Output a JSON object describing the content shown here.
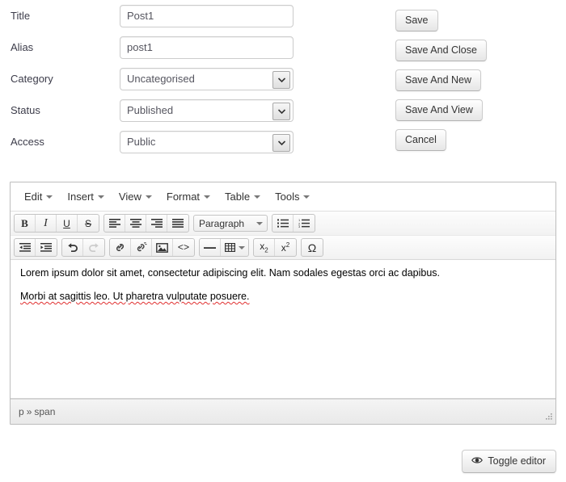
{
  "form": {
    "fields": [
      {
        "label": "Title",
        "type": "text",
        "value": "Post1",
        "placeholder": ""
      },
      {
        "label": "Alias",
        "type": "text",
        "value": "post1",
        "placeholder": ""
      },
      {
        "label": "Category",
        "type": "select",
        "value": "Uncategorised",
        "options": [
          "Uncategorised"
        ]
      },
      {
        "label": "Status",
        "type": "select",
        "value": "Published",
        "options": [
          "Published"
        ]
      },
      {
        "label": "Access",
        "type": "select",
        "value": "Public",
        "options": [
          "Public"
        ]
      }
    ]
  },
  "actions": {
    "buttons": [
      {
        "label": "Save"
      },
      {
        "label": "Save And Close"
      },
      {
        "label": "Save And New"
      },
      {
        "label": "Save And View"
      },
      {
        "label": "Cancel"
      }
    ]
  },
  "editor": {
    "menubar": [
      {
        "label": "Edit"
      },
      {
        "label": "Insert"
      },
      {
        "label": "View"
      },
      {
        "label": "Format"
      },
      {
        "label": "Table"
      },
      {
        "label": "Tools"
      }
    ],
    "toolbar_row1": {
      "group_format": [
        {
          "icon": "bold-icon",
          "title": "Bold"
        },
        {
          "icon": "italic-icon",
          "title": "Italic"
        },
        {
          "icon": "underline-icon",
          "title": "Underline"
        },
        {
          "icon": "strikethrough-icon",
          "title": "Strikethrough"
        }
      ],
      "group_align": [
        {
          "icon": "align-left-icon",
          "title": "Align left"
        },
        {
          "icon": "align-center-icon",
          "title": "Align center"
        },
        {
          "icon": "align-right-icon",
          "title": "Align right"
        },
        {
          "icon": "align-justify-icon",
          "title": "Justify"
        }
      ],
      "style_select": {
        "value": "Paragraph",
        "options": [
          "Paragraph"
        ]
      },
      "group_lists": [
        {
          "icon": "bullet-list-icon",
          "title": "Bullet list"
        },
        {
          "icon": "numbered-list-icon",
          "title": "Numbered list"
        }
      ]
    },
    "toolbar_row2": {
      "group_indent": [
        {
          "icon": "outdent-icon",
          "title": "Decrease indent"
        },
        {
          "icon": "indent-icon",
          "title": "Increase indent"
        }
      ],
      "group_history": [
        {
          "icon": "undo-icon",
          "title": "Undo",
          "disabled": false
        },
        {
          "icon": "redo-icon",
          "title": "Redo",
          "disabled": true
        }
      ],
      "group_insert": [
        {
          "icon": "link-icon",
          "title": "Insert/edit link"
        },
        {
          "icon": "unlink-icon",
          "title": "Remove link"
        },
        {
          "icon": "image-icon",
          "title": "Insert/edit image"
        },
        {
          "icon": "sourcecode-icon",
          "title": "Source code"
        }
      ],
      "group_objects": [
        {
          "icon": "horizontal-rule-icon",
          "title": "Horizontal line"
        },
        {
          "icon": "table-icon",
          "title": "Table",
          "has_caret": true
        }
      ],
      "group_script": [
        {
          "icon": "subscript-icon",
          "title": "Subscript",
          "glyph": "x₂"
        },
        {
          "icon": "superscript-icon",
          "title": "Superscript",
          "glyph": "x²"
        }
      ],
      "group_special": [
        {
          "icon": "special-character-icon",
          "title": "Special character",
          "glyph": "Ω"
        }
      ]
    },
    "content": {
      "paragraphs": [
        {
          "text": "Lorem ipsum dolor sit amet, consectetur adipiscing elit. Nam sodales egestas orci ac dapibus.",
          "misspelled": false
        },
        {
          "text": "Morbi at sagittis leo. Ut pharetra vulputate posuere.",
          "misspelled": true
        }
      ]
    },
    "statusbar": {
      "path": [
        "p",
        "span"
      ],
      "separator": "»"
    }
  },
  "footer": {
    "toggle_button": {
      "label": "Toggle editor",
      "icon": "eye-icon"
    }
  },
  "colors": {
    "page_background": "#ffffff",
    "field_border": "#cccccc",
    "editor_border": "#bdbdbd",
    "text": "#333333",
    "spellcheck_underline": "#e03030",
    "toolbar_gradient_top": "#fdfdfd",
    "toolbar_gradient_bottom": "#f2f2f2"
  }
}
